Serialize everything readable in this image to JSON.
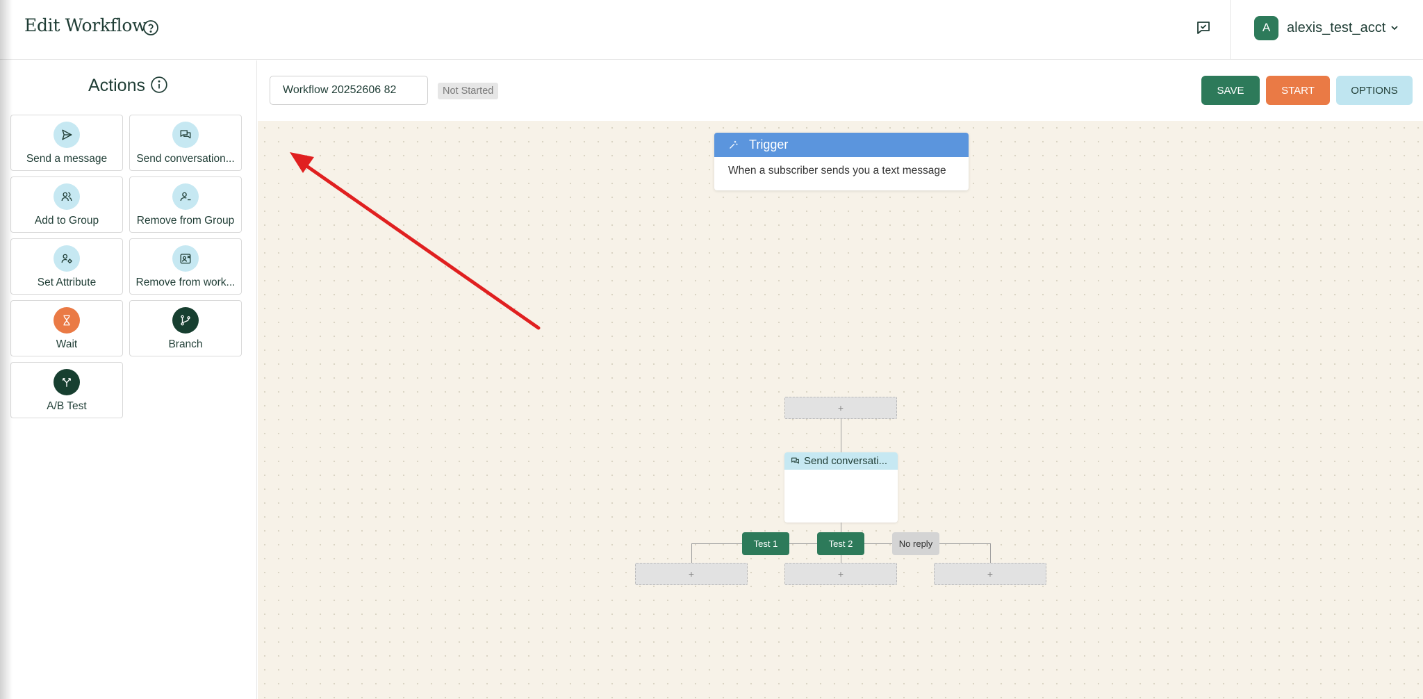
{
  "header": {
    "title": "Edit Workflow",
    "user": {
      "initial": "A",
      "name": "alexis_test_acct"
    }
  },
  "sidebar": {
    "title": "Actions",
    "actions": [
      {
        "label": "Send a message",
        "icon": "send-icon"
      },
      {
        "label": "Send conversation...",
        "icon": "conversation-icon"
      },
      {
        "label": "Add to Group",
        "icon": "add-group-icon"
      },
      {
        "label": "Remove from Group",
        "icon": "remove-group-icon"
      },
      {
        "label": "Set Attribute",
        "icon": "attribute-icon"
      },
      {
        "label": "Remove from work...",
        "icon": "remove-workflow-icon"
      },
      {
        "label": "Wait",
        "icon": "hourglass-icon",
        "color": "#ea7a45"
      },
      {
        "label": "Branch",
        "icon": "branch-icon",
        "color": "#173f30"
      },
      {
        "label": "A/B Test",
        "icon": "ab-test-icon",
        "color": "#173f30"
      }
    ]
  },
  "toolbar": {
    "workflow_name": "Workflow 20252606 82",
    "status": "Not Started",
    "save_label": "SAVE",
    "start_label": "START",
    "options_label": "OPTIONS"
  },
  "canvas": {
    "trigger": {
      "title": "Trigger",
      "description": "When a subscriber sends you a text message"
    },
    "add_symbol": "+",
    "send_node": {
      "title": "Send conversati..."
    },
    "branches": [
      "Test 1",
      "Test 2",
      "No reply"
    ]
  },
  "colors": {
    "primary": "#2d7a5a",
    "accent_orange": "#ea7a45",
    "light_blue": "#bfe5f0",
    "trigger_blue": "#5b95dd",
    "canvas_bg": "#f7f2e8",
    "annotation_arrow": "#e02020"
  }
}
